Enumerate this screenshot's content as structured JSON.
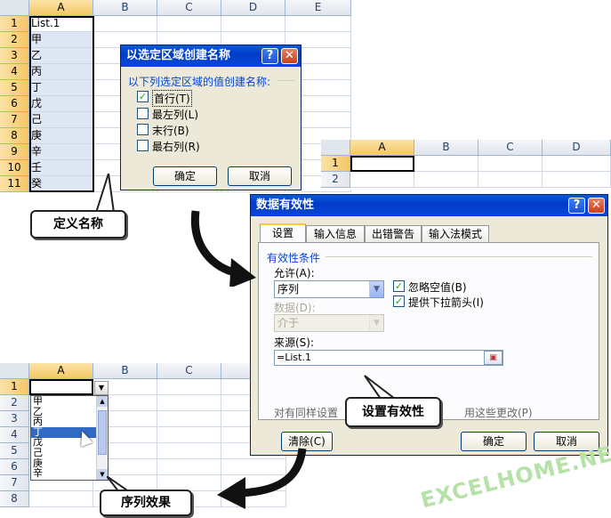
{
  "sheet1": {
    "columns": [
      "A",
      "B",
      "C",
      "D",
      "E"
    ],
    "rows": [
      "1",
      "2",
      "3",
      "4",
      "5",
      "6",
      "7",
      "8",
      "9",
      "10",
      "11"
    ],
    "values": [
      "List.1",
      "甲",
      "乙",
      "丙",
      "丁",
      "戊",
      "己",
      "庚",
      "辛",
      "壬",
      "癸"
    ]
  },
  "dialog_name": {
    "title": "以选定区域创建名称",
    "help": "?",
    "close": "✕",
    "group_label": "以下列选定区域的值创建名称:",
    "options": [
      {
        "label": "首行(T)",
        "checked": true
      },
      {
        "label": "最左列(L)",
        "checked": false
      },
      {
        "label": "末行(B)",
        "checked": false
      },
      {
        "label": "最右列(R)",
        "checked": false
      }
    ],
    "ok": "确定",
    "cancel": "取消"
  },
  "sheet2": {
    "columns": [
      "A",
      "B",
      "C",
      "D"
    ],
    "rows": [
      "1",
      "2"
    ]
  },
  "dialog_validation": {
    "title": "数据有效性",
    "help": "?",
    "close": "✕",
    "tabs": [
      "设置",
      "输入信息",
      "出错警告",
      "输入法模式"
    ],
    "group_label": "有效性条件",
    "allow_label": "允许(A):",
    "allow_value": "序列",
    "data_label": "数据(D):",
    "data_value": "介于",
    "ignore_blank": "忽略空值(B)",
    "dropdown": "提供下拉箭头(I)",
    "source_label": "来源(S):",
    "source_value": "=List.1",
    "apply_text": "对有同样设置",
    "apply_text2": "用这些更改(P)",
    "clear": "清除(C)",
    "ok": "确定",
    "cancel": "取消"
  },
  "sheet3": {
    "columns": [
      "A",
      "B",
      "C",
      "D"
    ],
    "rows": [
      "1",
      "2",
      "3",
      "4",
      "5",
      "6",
      "7",
      "8"
    ],
    "list": [
      "甲",
      "乙",
      "丙",
      "丁",
      "戊",
      "己",
      "庚",
      "辛"
    ]
  },
  "callouts": {
    "define": "定义名称",
    "validate": "设置有效性",
    "effect": "序列效果"
  },
  "watermark": "EXCELHOME.NET"
}
